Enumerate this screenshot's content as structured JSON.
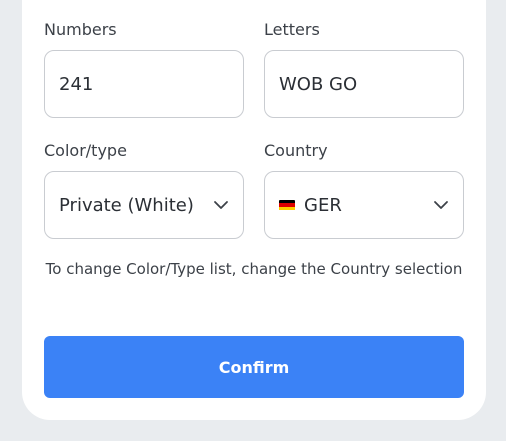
{
  "form": {
    "numbers": {
      "label": "Numbers",
      "value": "241"
    },
    "letters": {
      "label": "Letters",
      "value": "WOB GO"
    },
    "color_type": {
      "label": "Color/type",
      "selected": "Private (White)"
    },
    "country": {
      "label": "Country",
      "selected": "GER",
      "flag_colors": [
        "#000000",
        "#dd0000",
        "#ffce00"
      ]
    },
    "hint": "To change Color/Type list, change the Country selection",
    "confirm_label": "Confirm"
  },
  "colors": {
    "accent": "#3b82f6",
    "card_bg": "#ffffff",
    "page_bg": "#e9ecef",
    "border": "#c9ccd1"
  },
  "icons": {
    "dropdown": "chevron-down-icon",
    "flag": "germany-flag-icon"
  }
}
